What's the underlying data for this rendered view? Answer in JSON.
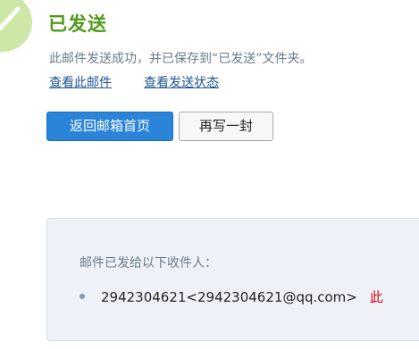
{
  "status": {
    "title": "已发送",
    "message": "此邮件发送成功，并已保存到“已发送”文件夹。"
  },
  "links": {
    "view_mail": "查看此邮件",
    "view_status": "查看发送状态"
  },
  "buttons": {
    "back_to_inbox": "返回邮箱首页",
    "write_again": "再写一封"
  },
  "recipients": {
    "label": "邮件已发给以下收件人：",
    "items": [
      {
        "address": "2942304621<2942304621@qq.com>",
        "extra": "此"
      }
    ]
  },
  "colors": {
    "success_green": "#4f9a1b",
    "primary_blue": "#2a84d8",
    "link_blue": "#1e5594",
    "panel_bg": "#eef2f8",
    "extra_red": "#d0021b"
  }
}
